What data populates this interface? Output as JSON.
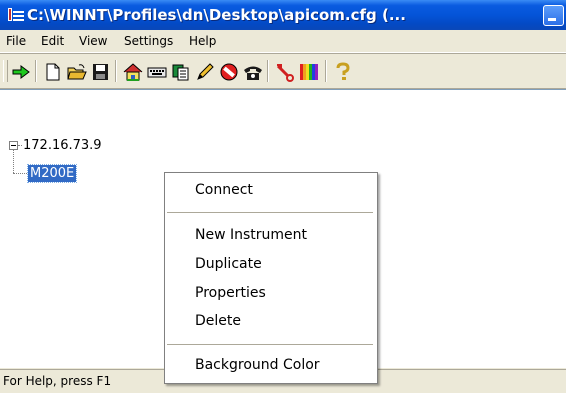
{
  "window": {
    "title": "C:\\WINNT\\Profiles\\dn\\Desktop\\apicom.cfg (..."
  },
  "menubar": {
    "items": [
      "File",
      "Edit",
      "View",
      "Settings",
      "Help"
    ]
  },
  "toolbar": {
    "buttons": [
      "connect-arrow-icon",
      "new-file-icon",
      "open-folder-icon",
      "save-disk-icon",
      "home-icon",
      "keyboard-icon",
      "copy-icon",
      "pencil-icon",
      "stop-icon",
      "phone-icon",
      "tools-icon",
      "color-bars-icon",
      "help-icon"
    ]
  },
  "tree": {
    "root": "172.16.73.9",
    "child": "M200E"
  },
  "context_menu": {
    "connect": "Connect",
    "new_instrument": "New Instrument",
    "duplicate": "Duplicate",
    "properties": "Properties",
    "delete": "Delete",
    "background_color": "Background Color"
  },
  "statusbar": {
    "text": "For Help, press F1"
  },
  "colors": {
    "titlebar": "#0454d8",
    "selection": "#316ac5",
    "chrome": "#ece9d8"
  }
}
